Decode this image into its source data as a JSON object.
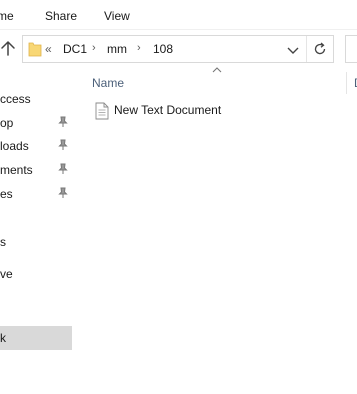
{
  "ribbon": {
    "tabs": [
      {
        "label": "me"
      },
      {
        "label": "Share"
      },
      {
        "label": "View"
      }
    ]
  },
  "address": {
    "overflow": "«",
    "crumbs": [
      "DC1",
      "mm",
      "108"
    ],
    "separator": "›"
  },
  "nav": {
    "items": [
      {
        "label": "ccess",
        "pinned": false,
        "selected": false
      },
      {
        "label": "op",
        "pinned": true,
        "selected": false
      },
      {
        "label": "loads",
        "pinned": true,
        "selected": false
      },
      {
        "label": "ments",
        "pinned": true,
        "selected": false
      },
      {
        "label": "es",
        "pinned": true,
        "selected": false
      },
      {
        "label": "",
        "pinned": false,
        "selected": false
      },
      {
        "label": "s",
        "pinned": false,
        "selected": false
      },
      {
        "label": "ve",
        "pinned": false,
        "selected": false
      },
      {
        "label": "k",
        "pinned": false,
        "selected": true
      }
    ]
  },
  "content": {
    "columns": [
      {
        "label": "Name"
      },
      {
        "label": "D"
      }
    ],
    "files": [
      {
        "name": "New Text Document",
        "icon": "text-document-icon"
      }
    ]
  },
  "colors": {
    "header_text": "#4c607a",
    "selection": "#d9d9d9",
    "folder": "#f8d775"
  }
}
